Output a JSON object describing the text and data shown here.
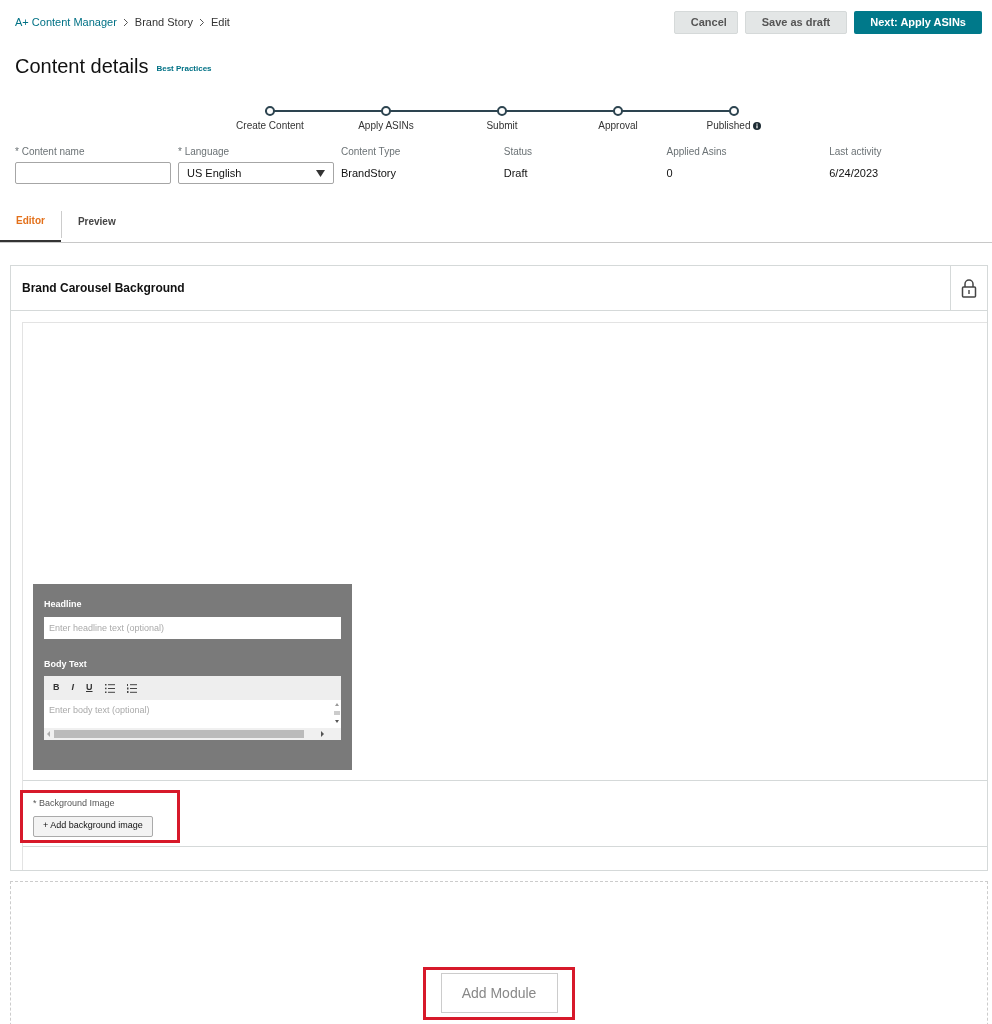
{
  "breadcrumb": [
    "A+ Content Manager",
    "Brand Story",
    "Edit"
  ],
  "actions": [
    {
      "label": "Cancel",
      "kind": "secondary"
    },
    {
      "label": "Save as draft",
      "kind": "secondary"
    },
    {
      "label": "Next: Apply ASINs",
      "kind": "primary"
    }
  ],
  "title": "Content details",
  "best_practices_link": "Best Practices",
  "steps": [
    {
      "label": "Create Content",
      "info": false
    },
    {
      "label": "Apply ASINs",
      "info": false
    },
    {
      "label": "Submit",
      "info": false
    },
    {
      "label": "Approval",
      "info": false
    },
    {
      "label": "Published",
      "info": true
    }
  ],
  "fields": [
    {
      "kind": "input",
      "label": "* Content name"
    },
    {
      "kind": "select",
      "label": "* Language",
      "value": "US English"
    },
    {
      "kind": "text",
      "label": "Content Type",
      "value": "BrandStory"
    },
    {
      "kind": "text",
      "label": "Status",
      "value": "Draft"
    },
    {
      "kind": "text",
      "label": "Applied Asins",
      "value": "0"
    },
    {
      "kind": "text",
      "label": "Last activity",
      "value": "6/24/2023"
    }
  ],
  "tabs": [
    {
      "label": "Editor",
      "selected": true
    },
    {
      "label": "Preview",
      "selected": false
    }
  ],
  "module": {
    "title": "Brand Carousel Background",
    "overlay": {
      "headline_label": "Headline",
      "headline_placeholder": "Enter headline text (optional)",
      "body_label": "Body Text",
      "toolbar": [
        "B",
        "I",
        "U"
      ],
      "body_placeholder": "Enter body text (optional)"
    },
    "background_label": "* Background Image",
    "background_button": "+ Add background image",
    "background_highlighted": true
  },
  "add_module": {
    "label": "Add Module",
    "highlighted": true
  }
}
